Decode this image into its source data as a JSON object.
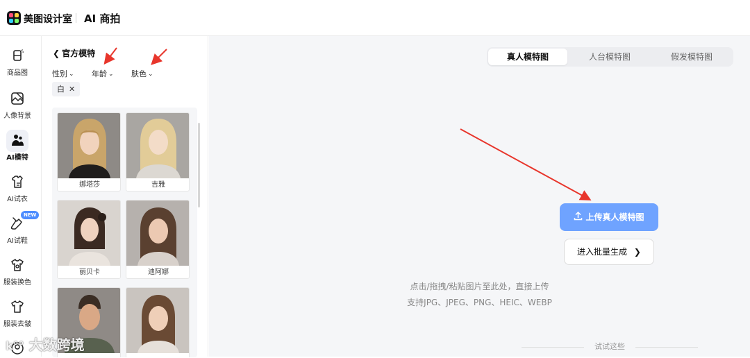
{
  "header": {
    "brand": "美图设计室",
    "product": "AI 商拍"
  },
  "leftnav": {
    "items": [
      {
        "label": "商品图",
        "icon": "product-image-icon"
      },
      {
        "label": "人像背景",
        "icon": "portrait-background-icon"
      },
      {
        "label": "AI模特",
        "icon": "ai-model-icon",
        "active": true
      },
      {
        "label": "AI试衣",
        "icon": "ai-try-on-icon"
      },
      {
        "label": "AI试鞋",
        "icon": "ai-shoe-icon",
        "badge": "NEW"
      },
      {
        "label": "服装换色",
        "icon": "clothing-recolor-icon"
      },
      {
        "label": "服装去皱",
        "icon": "clothing-dewrinkle-icon"
      },
      {
        "label": "",
        "icon": "user-icon"
      }
    ]
  },
  "panel": {
    "back_label": "官方模特",
    "filters": [
      "性别",
      "年龄",
      "肤色"
    ],
    "active_chip": "白",
    "models": [
      {
        "name": "娜塔莎"
      },
      {
        "name": "吉雅"
      },
      {
        "name": "丽贝卡"
      },
      {
        "name": "迪阿娜"
      },
      {
        "name": ""
      },
      {
        "name": ""
      }
    ]
  },
  "main": {
    "tabs": [
      {
        "label": "真人模特图",
        "active": true
      },
      {
        "label": "人台模特图"
      },
      {
        "label": "假发模特图"
      }
    ],
    "upload_label": "上传真人模特图",
    "batch_label": "进入批量生成",
    "hint_line1": "点击/拖拽/粘贴图片至此处，直接上传",
    "hint_line2": "支持JPG、JPEG、PNG、HEIC、WEBP",
    "try_label": "试试这些"
  },
  "watermark": "大数跨境",
  "colors": {
    "accent": "#6fa3ff",
    "annotation_arrow": "#e8362c",
    "main_bg": "#f5f6f8"
  }
}
